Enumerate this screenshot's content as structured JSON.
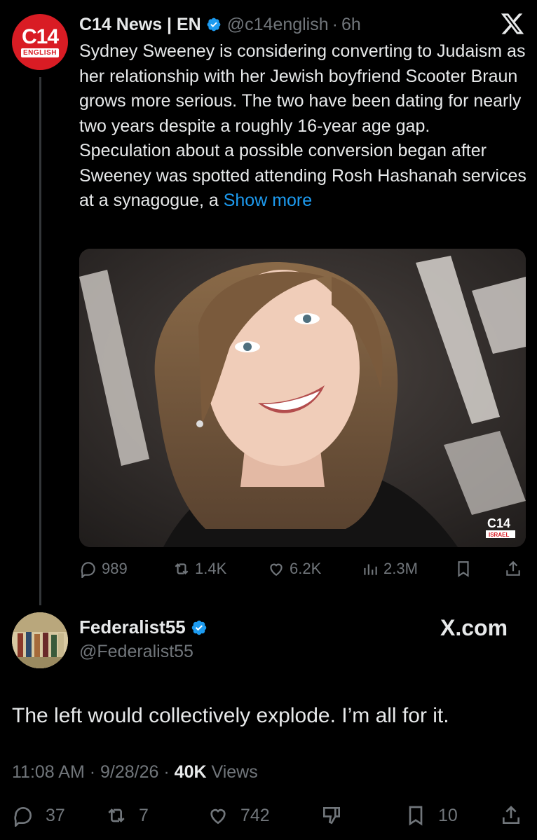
{
  "quoted_tweet": {
    "avatar": {
      "line1": "C14",
      "line2": "ENGLISH",
      "color": "#d91c24"
    },
    "name": "C14 News | EN",
    "handle": "@c14english",
    "separator": "·",
    "time": "6h",
    "text_paragraphs": [
      "Sydney Sweeney is considering converting to Judaism as her relationship with her Jewish boyfriend Scooter Braun grows more serious. The two have been dating for nearly two years despite a roughly 16-year age gap.",
      "Speculation about a possible conversion began after Sweeney was spotted attending Rosh Hashanah services at a synagogue, a "
    ],
    "show_more": "Show more",
    "media_watermark": {
      "line1": "C14",
      "line2": "ISRAEL"
    },
    "stats": {
      "replies": "989",
      "reposts": "1.4K",
      "likes": "6.2K",
      "views": "2.3M"
    }
  },
  "main_tweet": {
    "name": "Federalist55",
    "handle": "@Federalist55",
    "brand": "X.com",
    "text": "The left would collectively explode. I’m all for it.",
    "time": "11:08 AM",
    "date": "9/28/26",
    "sep": "·",
    "views_count": "40K",
    "views_label": "Views",
    "stats": {
      "replies": "37",
      "reposts": "7",
      "likes": "742",
      "bookmarks": "10"
    }
  },
  "colors": {
    "accent": "#1d9bf0",
    "muted": "#71767b",
    "text": "#e7e9ea",
    "background": "#000000"
  },
  "icons": [
    "verified-badge-icon",
    "x-logo-icon",
    "reply-icon",
    "repost-icon",
    "like-icon",
    "views-icon",
    "bookmark-icon",
    "share-icon",
    "dislike-icon"
  ]
}
